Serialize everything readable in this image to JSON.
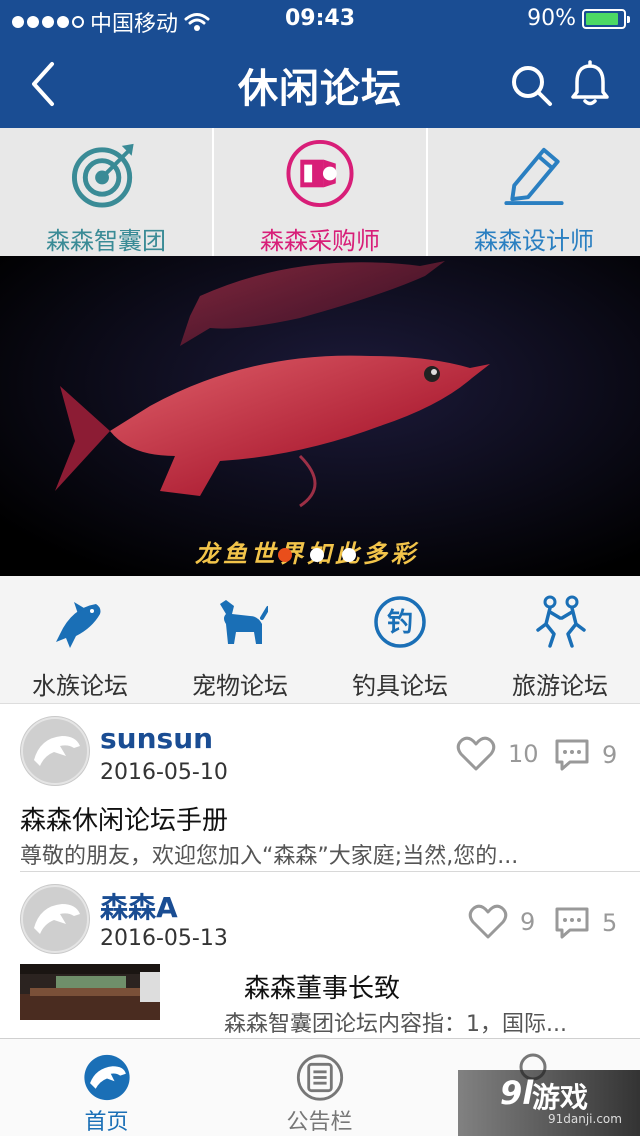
{
  "status_bar": {
    "carrier": "中国移动",
    "time": "09:43",
    "battery_percent": "90%",
    "battery_level": 0.9,
    "signal_bars_filled": 4,
    "signal_bars_total": 5
  },
  "nav": {
    "title": "休闲论坛"
  },
  "categories": [
    {
      "label": "森森智囊团",
      "icon": "target-icon",
      "color": "#3a8b96"
    },
    {
      "label": "森森采购师",
      "icon": "camera-icon",
      "color": "#d81e78"
    },
    {
      "label": "森森设计师",
      "icon": "pencil-icon",
      "color": "#2a7fc1"
    }
  ],
  "banner": {
    "caption": "龙鱼世界如此多彩",
    "page_count": 3,
    "active_page": 0
  },
  "forums": [
    {
      "label": "水族论坛",
      "icon": "fish-icon"
    },
    {
      "label": "宠物论坛",
      "icon": "dog-icon"
    },
    {
      "label": "钓具论坛",
      "icon": "fishing-icon",
      "glyph": "钓"
    },
    {
      "label": "旅游论坛",
      "icon": "travel-icon"
    }
  ],
  "posts": [
    {
      "author": "sunsun",
      "date": "2016-05-10",
      "likes": "10",
      "comments": "9",
      "title": "森森休闲论坛手册",
      "excerpt": "尊敬的朋友，欢迎您加入“森森”大家庭;当然,您的..."
    },
    {
      "author": "森森A",
      "date": "2016-05-13",
      "likes": "9",
      "comments": "5",
      "title": "森森董事长致",
      "excerpt": "森森智囊团论坛内容指：1，国际..."
    }
  ],
  "tabbar": [
    {
      "label": "首页",
      "icon": "home-dolphin-icon",
      "active": true
    },
    {
      "label": "公告栏",
      "icon": "notice-list-icon",
      "active": false
    },
    {
      "label": "",
      "icon": "profile-icon",
      "active": false
    }
  ],
  "watermark": {
    "logo": "9l",
    "text": "游戏",
    "url": "91danji.com"
  },
  "colors": {
    "nav_blue": "#1a4d93",
    "accent_blue": "#1a6fb6",
    "battery_green": "#4cd964",
    "pager_active": "#e94e1b"
  }
}
